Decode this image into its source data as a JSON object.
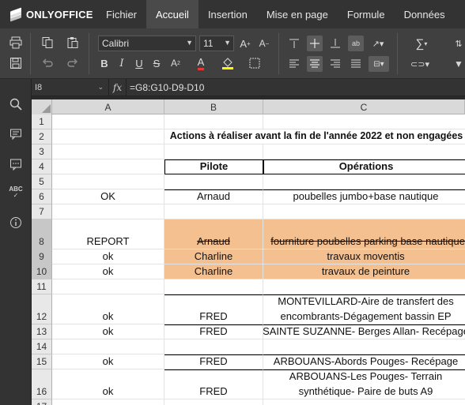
{
  "app": {
    "logo": "ONLYOFFICE"
  },
  "menu": [
    {
      "label": "Fichier",
      "active": false
    },
    {
      "label": "Accueil",
      "active": true
    },
    {
      "label": "Insertion",
      "active": false
    },
    {
      "label": "Mise en page",
      "active": false
    },
    {
      "label": "Formule",
      "active": false
    },
    {
      "label": "Données",
      "active": false
    }
  ],
  "toolbar": {
    "font_name": "Calibri",
    "font_size": "11"
  },
  "formula_bar": {
    "cell_ref": "I8",
    "fx": "fx",
    "formula": "=G8:G10-D9-D10"
  },
  "columns": [
    "A",
    "B",
    "C"
  ],
  "rows": [
    {
      "num": "1",
      "a": "",
      "b": "",
      "c": ""
    },
    {
      "num": "2",
      "a": "",
      "b": "",
      "c": "",
      "title": "Actions à  réaliser avant la fin de l'année 2022 et non engagées"
    },
    {
      "num": "3",
      "a": "",
      "b": "",
      "c": ""
    },
    {
      "num": "4",
      "a": "",
      "b": "Pilote",
      "c": "Opérations"
    },
    {
      "num": "5",
      "a": "",
      "b": "",
      "c": ""
    },
    {
      "num": "6",
      "a": "OK",
      "b": "Arnaud",
      "c": "poubelles jumbo+base nautique"
    },
    {
      "num": "7",
      "a": "",
      "b": "",
      "c": ""
    },
    {
      "num": "8",
      "a": "REPORT",
      "b": "Arnaud",
      "c": "fourniture poubelles parking base nautique"
    },
    {
      "num": "9",
      "a": "ok",
      "b": "Charline",
      "c": "travaux moventis"
    },
    {
      "num": "10",
      "a": "ok",
      "b": "Charline",
      "c": "travaux de peinture"
    },
    {
      "num": "11",
      "a": "",
      "b": "",
      "c": ""
    },
    {
      "num": "12",
      "a": "ok",
      "b": "FRED",
      "c": "MONTEVILLARD-Aire de transfert des encombrants-Dégagement bassin EP"
    },
    {
      "num": "13",
      "a": "ok",
      "b": "FRED",
      "c": "SAINTE SUZANNE- Berges Allan- Recépage"
    },
    {
      "num": "14",
      "a": "",
      "b": "",
      "c": ""
    },
    {
      "num": "15",
      "a": "ok",
      "b": "FRED",
      "c": "ARBOUANS-Abords Pouges- Recépage"
    },
    {
      "num": "16",
      "a": "ok",
      "b": "FRED",
      "c": "ARBOUANS-Les Pouges- Terrain synthétique- Paire de buts A9"
    },
    {
      "num": "17",
      "a": "",
      "b": "",
      "c": ""
    }
  ],
  "colors": {
    "highlight": "#f4c08f",
    "header_bg": "#333333",
    "toolbar_bg": "#404040"
  }
}
